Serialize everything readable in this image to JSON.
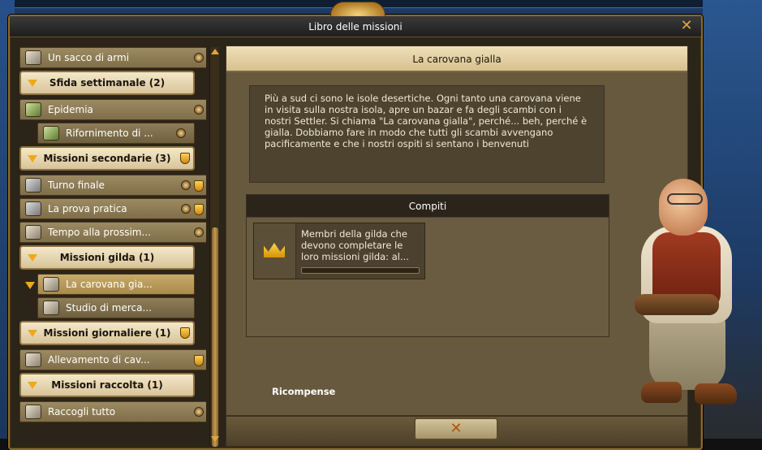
{
  "window": {
    "title": "Libro delle missioni",
    "close_glyph": "✕"
  },
  "list": {
    "rows": [
      {
        "type": "item",
        "label": "Un sacco di armi",
        "icon": "scroll-icon",
        "badges": [
          "scroll-badge"
        ]
      },
      {
        "type": "category",
        "label": "Sfida settimanale (2)",
        "badges": []
      },
      {
        "type": "item",
        "label": "Epidemia",
        "icon": "herb-icon",
        "badges": [
          "scroll-badge"
        ]
      },
      {
        "type": "item",
        "label": "Rifornimento di ...",
        "icon": "herb-icon",
        "badges": [
          "scroll-badge"
        ]
      },
      {
        "type": "category",
        "label": "Missioni secondarie (3)",
        "badges": [
          "cup-badge"
        ]
      },
      {
        "type": "item",
        "label": "Turno finale",
        "icon": "swords-icon",
        "badges": [
          "scroll-badge",
          "cup-badge"
        ]
      },
      {
        "type": "item",
        "label": "La prova pratica",
        "icon": "swords-icon",
        "badges": [
          "scroll-badge",
          "cup-badge"
        ]
      },
      {
        "type": "item",
        "label": "Tempo alla prossim...",
        "icon": "scroll-icon",
        "badges": [
          "scroll-badge"
        ]
      },
      {
        "type": "category",
        "label": "Missioni gilda (1)",
        "badges": []
      },
      {
        "type": "item",
        "label": "La carovana gia...",
        "icon": "scroll-icon",
        "badges": [],
        "selected": true
      },
      {
        "type": "item",
        "label": "Studio di merca...",
        "icon": "scroll-icon",
        "badges": []
      },
      {
        "type": "category",
        "label": "Missioni giornaliere (1)",
        "badges": [
          "cup-badge"
        ]
      },
      {
        "type": "item",
        "label": "Allevamento di cav...",
        "icon": "scroll-icon",
        "badges": [
          "cup-badge"
        ]
      },
      {
        "type": "category",
        "label": "Missioni raccolta (1)",
        "badges": []
      },
      {
        "type": "item",
        "label": "Raccogli tutto",
        "icon": "scroll-icon",
        "badges": [
          "scroll-badge"
        ]
      }
    ]
  },
  "detail": {
    "title": "La carovana gialla",
    "description": "Più a sud ci sono le isole desertiche. Ogni tanto una carovana viene in visita sulla nostra isola, apre un bazar e fa degli scambi con i nostri Settler. Si chiama \"La carovana gialla\", perché... beh, perché è gialla. Dobbiamo fare in modo che tutti gli scambi avvengano pacificamente e che i nostri ospiti si sentano i benvenuti",
    "tasks_title": "Compiti",
    "task": {
      "text": "Membri della gilda che devono completare le loro missioni gilda: al...",
      "progress": 0
    },
    "rewards_label": "Ricompense"
  },
  "footer": {
    "close_glyph": "✕"
  },
  "colors": {
    "accent": "#e0a640",
    "category_bg": "#f4e8c8",
    "selected_row": "#c8aa6a"
  }
}
